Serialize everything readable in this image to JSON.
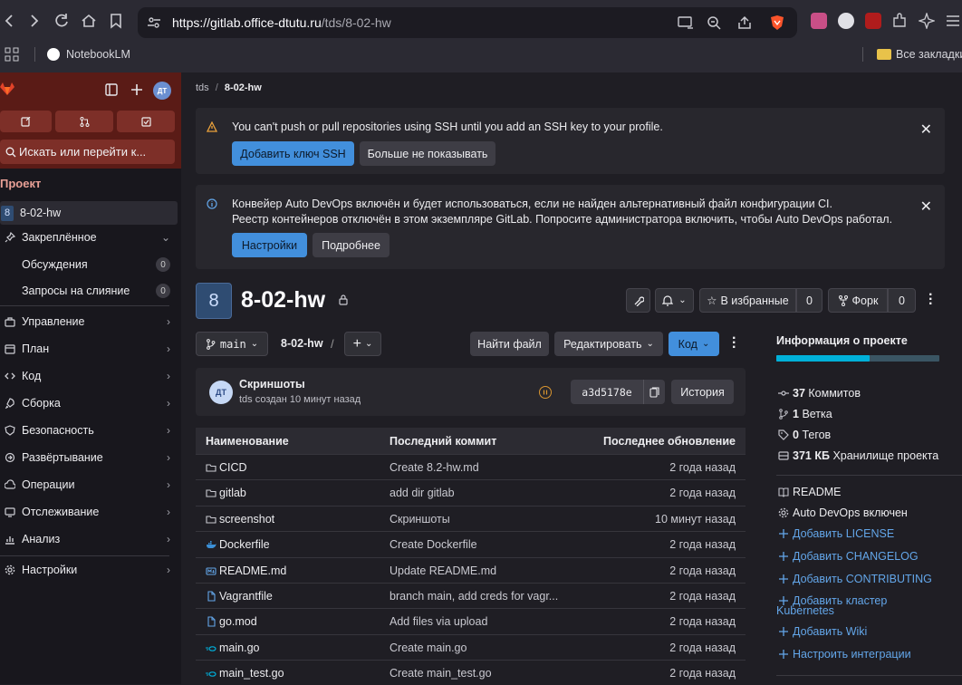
{
  "browser": {
    "url_host": "https://gitlab.office-dtutu.ru",
    "url_path": "/tds/8-02-hw",
    "bookmarks": {
      "left": "NotebookLM",
      "right": "Все закладки"
    }
  },
  "sidebar": {
    "avatar": "ДТ",
    "search": "Искать или перейти к...",
    "section": "Проект",
    "project": {
      "badge": "8",
      "name": "8-02-hw"
    },
    "pinned": "Закреплённое",
    "pinned_items": [
      {
        "label": "Обсуждения",
        "count": "0"
      },
      {
        "label": "Запросы на слияние",
        "count": "0"
      }
    ],
    "nav": [
      {
        "label": "Управление",
        "icon": "briefcase-icon"
      },
      {
        "label": "План",
        "icon": "calendar-icon"
      },
      {
        "label": "Код",
        "icon": "code-icon"
      },
      {
        "label": "Сборка",
        "icon": "rocket-icon"
      },
      {
        "label": "Безопасность",
        "icon": "shield-icon"
      },
      {
        "label": "Развёртывание",
        "icon": "deploy-icon"
      },
      {
        "label": "Операции",
        "icon": "cloud-icon"
      },
      {
        "label": "Отслеживание",
        "icon": "monitor-icon"
      },
      {
        "label": "Анализ",
        "icon": "chart-icon"
      }
    ],
    "settings": "Настройки"
  },
  "breadcrumb": {
    "group": "tds",
    "project": "8-02-hw"
  },
  "alerts": {
    "ssh": {
      "message": "You can't push or pull repositories using SSH until you add an SSH key to your profile.",
      "primary": "Добавить ключ SSH",
      "secondary": "Больше не показывать"
    },
    "devops": {
      "line1": "Конвейер Auto DevOps включён и будет использоваться, если не найден альтернативный файл конфигурации CI.",
      "line2": "Реестр контейнеров отключён в этом экземпляре GitLab. Попросите администратора включить, чтобы Auto DevOps работал.",
      "primary": "Настройки",
      "secondary": "Подробнее"
    }
  },
  "project": {
    "badge": "8",
    "title": "8-02-hw",
    "star_label": "В избранные",
    "star_count": "0",
    "fork_label": "Форк",
    "fork_count": "0"
  },
  "repo_toolbar": {
    "branch": "main",
    "path": "8-02-hw",
    "separator": "/",
    "find_file": "Найти файл",
    "edit": "Редактировать",
    "code": "Код"
  },
  "last_commit": {
    "avatar": "ДТ",
    "title": "Скриншоты",
    "author": "tds",
    "meta": "создан 10 минут назад",
    "sha": "a3d5178e",
    "history": "История"
  },
  "table": {
    "headers": [
      "Наименование",
      "Последний коммит",
      "Последнее обновление"
    ],
    "rows": [
      {
        "name": "CICD",
        "type": "folder",
        "commit": "Create 8.2-hw.md",
        "time": "2 года назад"
      },
      {
        "name": "gitlab",
        "type": "folder",
        "commit": "add dir gitlab",
        "time": "2 года назад"
      },
      {
        "name": "screenshot",
        "type": "folder",
        "commit": "Скриншоты",
        "time": "10 минут назад"
      },
      {
        "name": "Dockerfile",
        "type": "docker",
        "commit": "Create Dockerfile",
        "time": "2 года назад"
      },
      {
        "name": "README.md",
        "type": "markdown",
        "commit": "Update README.md",
        "time": "2 года назад"
      },
      {
        "name": "Vagrantfile",
        "type": "file",
        "commit": "branch main, add creds for vagr...",
        "time": "2 года назад"
      },
      {
        "name": "go.mod",
        "type": "file",
        "commit": "Add files via upload",
        "time": "2 года назад"
      },
      {
        "name": "main.go",
        "type": "go",
        "commit": "Create main.go",
        "time": "2 года назад"
      },
      {
        "name": "main_test.go",
        "type": "go",
        "commit": "Create main_test.go",
        "time": "2 года назад"
      }
    ]
  },
  "project_info": {
    "heading": "Информация о проекте",
    "language_split": 0.57,
    "stats": [
      {
        "icon": "commit-icon",
        "value": "37",
        "label": "Коммитов"
      },
      {
        "icon": "branch-icon",
        "value": "1",
        "label": "Ветка"
      },
      {
        "icon": "tag-icon",
        "value": "0",
        "label": "Тегов"
      },
      {
        "icon": "storage-icon",
        "value": "371 КБ",
        "label": "Хранилище проекта"
      }
    ],
    "links": [
      {
        "icon": "book-icon",
        "label": "README",
        "add": false
      },
      {
        "icon": "gear-icon",
        "label": "Auto DevOps включен",
        "add": false
      },
      {
        "icon": "plus-icon",
        "label": "Добавить LICENSE",
        "add": true
      },
      {
        "icon": "plus-icon",
        "label": "Добавить CHANGELOG",
        "add": true
      },
      {
        "icon": "plus-icon",
        "label": "Добавить CONTRIBUTING",
        "add": true
      },
      {
        "icon": "plus-icon",
        "label": "Добавить кластер",
        "label2": "Kubernetes",
        "add": true
      },
      {
        "icon": "plus-icon",
        "label": "Добавить Wiki",
        "add": true
      },
      {
        "icon": "plus-icon",
        "label": "Настроить интеграции",
        "add": true
      }
    ]
  },
  "colors": {
    "accent": "#428fdc",
    "sidebar_top": "#5a1b16",
    "lang_primary": "#00b0d8",
    "lang_secondary": "#3a5563"
  }
}
